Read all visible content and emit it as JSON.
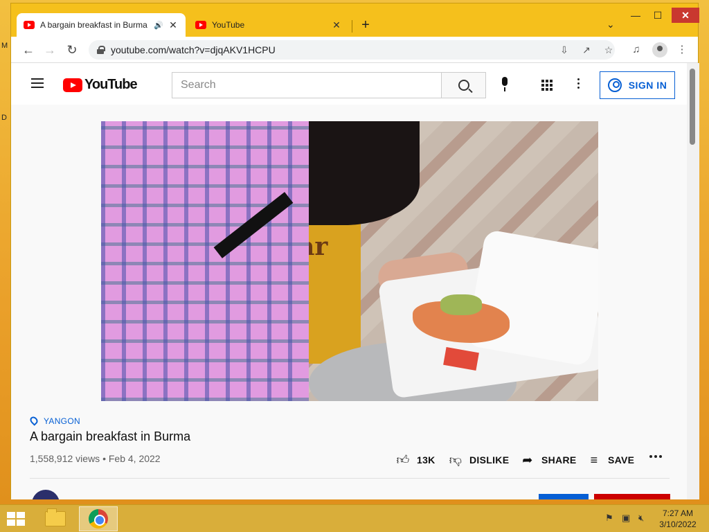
{
  "desktop": {
    "edge_letters": [
      "M",
      "D"
    ]
  },
  "browser": {
    "tabs": [
      {
        "title": "A bargain breakfast in Burma",
        "active": true,
        "audio": true
      },
      {
        "title": "YouTube",
        "active": false
      }
    ],
    "new_tab": "+",
    "close_glyph": "✕",
    "window_controls": {
      "minimize": "—",
      "maximize": "☐",
      "close": "✕"
    },
    "url": "youtube.com/watch?v=djqAKV1HCPU"
  },
  "youtube": {
    "logo_text": "YouTube",
    "search_placeholder": "Search",
    "sign_in": "SIGN IN",
    "video": {
      "location": "YANGON",
      "title": "A bargain breakfast in Burma",
      "meta": "1,558,912 views • Feb 4, 2022",
      "shirt_text": "bear"
    },
    "actions": {
      "like_count": "13K",
      "dislike": "DISLIKE",
      "share": "SHARE",
      "save": "SAVE"
    }
  },
  "taskbar": {
    "time": "7:27 AM",
    "date": "3/10/2022"
  },
  "colors": {
    "accent": "#065fd4",
    "youtube_red": "#ff0000",
    "window_frame": "#f5c01c"
  }
}
